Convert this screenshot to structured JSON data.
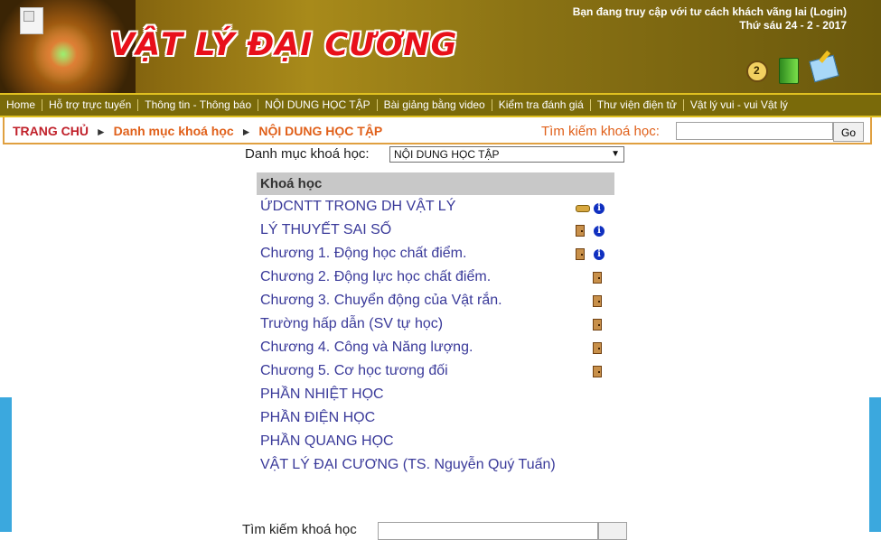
{
  "header": {
    "site_title": "VẬT LÝ ĐẠI CƯƠNG",
    "guest_notice": "Bạn đang truy cập với tư cách khách vãng lai (Login)",
    "date": "Thứ sáu 24 - 2 - 2017",
    "icons": [
      "help-icon",
      "book-icon",
      "edit-icon"
    ]
  },
  "nav": {
    "items": [
      "Home",
      "Hỗ trợ trực tuyến",
      "Thông tin - Thông báo",
      "NỘI DUNG HỌC TẬP",
      "Bài giảng bằng video",
      "Kiểm tra đánh giá",
      "Thư viện điện tử",
      "Vật lý vui - vui Vật lý"
    ]
  },
  "breadcrumb": {
    "home": "TRANG CHỦ",
    "sep": "►",
    "level1": "Danh mục khoá học",
    "level2": "NỘI DUNG HỌC TẬP"
  },
  "search": {
    "label": "Tìm kiếm khoá học:",
    "value": "",
    "button": "Go"
  },
  "category": {
    "label": "Danh mục khoá học:",
    "selected": "NỘI DUNG HỌC TẬP"
  },
  "courses": {
    "header": "Khoá học",
    "items": [
      {
        "name": "ỨDCNTT TRONG DH VẬT LÝ",
        "icons": [
          "key-icon",
          "info-icon"
        ]
      },
      {
        "name": "LÝ THUYẾT SAI SỐ",
        "icons": [
          "guest-access-icon",
          "info-icon"
        ]
      },
      {
        "name": "Chương 1. Động học chất điểm.",
        "icons": [
          "guest-access-icon",
          "info-icon"
        ]
      },
      {
        "name": "Chương 2. Động lực học chất điểm.",
        "icons": [
          "guest-access-icon"
        ]
      },
      {
        "name": "Chương 3. Chuyển động của Vật rắn.",
        "icons": [
          "guest-access-icon"
        ]
      },
      {
        "name": "Trường hấp dẫn (SV tự học)",
        "icons": [
          "guest-access-icon"
        ]
      },
      {
        "name": "Chương 4. Công và Năng lượng.",
        "icons": [
          "guest-access-icon"
        ]
      },
      {
        "name": "Chương 5. Cơ học tương đối",
        "icons": [
          "guest-access-icon"
        ]
      },
      {
        "name": "PHẦN NHIỆT HỌC",
        "icons": []
      },
      {
        "name": "PHẦN ĐIỆN HỌC",
        "icons": []
      },
      {
        "name": "PHẦN QUANG HỌC",
        "icons": []
      },
      {
        "name": "VẬT LÝ ĐẠI CƯƠNG (TS. Nguyễn Quý Tuấn)",
        "icons": []
      }
    ]
  },
  "bottom_search": {
    "label": "Tìm kiếm khoá học"
  },
  "colors": {
    "link": "#3a3a9a",
    "crumb_home": "#c0202a",
    "crumb_link": "#e0601a",
    "nav_bg": "#7a6a0a"
  }
}
